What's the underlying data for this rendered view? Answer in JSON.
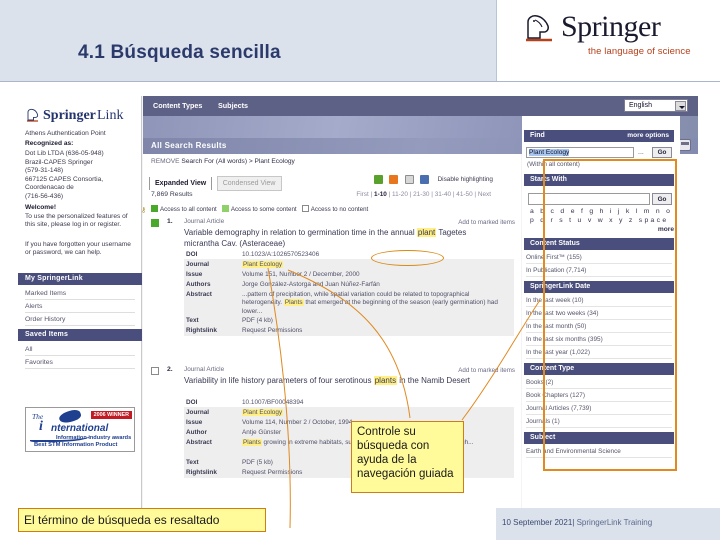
{
  "slide": {
    "title": "4.1 Búsqueda sencilla",
    "brand": {
      "word_bold": "Springer",
      "word_light": "",
      "tagline": "the language of science"
    },
    "footer": {
      "date": "10 September 2021",
      "separator": "|",
      "label": "SpringerLink Training"
    }
  },
  "annotations": {
    "bottom_callout": "El término de búsqueda es resaltado",
    "guided_callout": "Controle su búsqueda con ayuda de la navegación guiada"
  },
  "left_sidebar": {
    "logo": {
      "bold": "Springer",
      "light": "Link"
    },
    "auth_point": "Athens Authentication Point",
    "recognized_label": "Recognized as:",
    "institutions": [
      "Dot Lib LTDA (636-05-948)",
      "Brazil-CAPES Springer",
      "(579-31-148)",
      "667125 CAPES Consortia,",
      "Coordenacao de",
      "(716-56-436)"
    ],
    "welcome_label": "Welcome!",
    "welcome_text": "To use the personalized features of this site, please log in or register.",
    "help_text": "If you have forgotten your username or password, we can help.",
    "sections": [
      {
        "title": "My SpringerLink",
        "items": [
          "Marked Items",
          "Alerts",
          "Order History"
        ]
      },
      {
        "title": "Saved Items",
        "items": [
          "All",
          "Favorites"
        ]
      }
    ],
    "award": {
      "the": "The",
      "name": "nternational",
      "winner": "2006 WINNER",
      "line1": "Information industry awards",
      "line2": "Best STM Information Product"
    }
  },
  "topbar": {
    "menu": [
      "Content Types",
      "Subjects"
    ],
    "language": "English"
  },
  "results_header": {
    "title": "All Search Results",
    "refine_remove": "REMOVE",
    "refine_text": "Search For (All words) > Plant Ecology",
    "tab_expanded": "Expanded View",
    "tab_condensed": "Condensed View",
    "result_count": "7,869 Results",
    "disable_highlighting": "Disable highlighting",
    "pager": [
      "First",
      "1-10",
      "11-20",
      "21-30",
      "31-40",
      "41-50",
      "Next"
    ],
    "legend": [
      "Access to all content",
      "Access to some content",
      "Access to no content"
    ]
  },
  "results": [
    {
      "num": "1.",
      "type": "Journal Article",
      "title_pre": "Variable demography in relation to germination time in the annual ",
      "title_hl": "plant",
      "title_post": " Tagetes micrantha Cav. (Asteraceae)",
      "mark": "Add to marked items",
      "rows": [
        {
          "label": "DOI",
          "value": "10.1023/A:1026570523406"
        },
        {
          "label": "Journal",
          "value": "Plant  Ecology",
          "highlight": true
        },
        {
          "label": "Issue",
          "value": "Volume 151, Number 2 / December, 2000"
        },
        {
          "label": "Authors",
          "value": "Jorge González-Astorga and Juan Núñez-Farfán"
        },
        {
          "label": "Abstract",
          "value_pre": "...pattern of precipitation, while spatial variation could be related to topographical heterogeneity. ",
          "value_hl": "Plants",
          "value_post": " that emerged at the beginning of the season (early germination) had lower..."
        },
        {
          "label": "Text",
          "value": "PDF (4 kb)"
        },
        {
          "label": "Rightslink",
          "value": "Request Permissions"
        }
      ]
    },
    {
      "num": "2.",
      "type": "Journal Article",
      "title_pre": "Variability in life history parameters of four serotinous ",
      "title_hl": "plants",
      "title_post": " in the Namib Desert",
      "mark": "Add to marked items",
      "rows": [
        {
          "label": "DOI",
          "value": "10.1007/BF00048394"
        },
        {
          "label": "Journal",
          "value": "Plant  Ecology",
          "highlight": true
        },
        {
          "label": "Issue",
          "value": "Volume 114, Number 2 / October, 1994"
        },
        {
          "label": "Author",
          "value": "Antje Günster"
        },
        {
          "label": "Abstract",
          "value_pre": "",
          "value_hl": "Plants",
          "value_post": " growing in extreme habitats, such as deserts, are expected to show high..."
        },
        {
          "label": "Text",
          "value": "PDF (5 kb)"
        },
        {
          "label": "Rightslink",
          "value": "Request Permissions"
        }
      ]
    }
  ],
  "right_sidebar": {
    "find": {
      "title": "Find",
      "more_options": "more options",
      "query": "Plant Ecology",
      "dots": "...",
      "go": "Go",
      "within": "(Within all content)"
    },
    "starts_with": {
      "title": "Starts With",
      "go": "Go",
      "alpha_row1": "a b c d e f g h i j k l m n o",
      "alpha_row2": "p q r s t u v w x y z space",
      "more": "more"
    },
    "content_status": {
      "title": "Content Status",
      "items": [
        "Online First™ (155)",
        "In Publication (7,714)"
      ]
    },
    "springerlink_date": {
      "title": "SpringerLink Date",
      "items": [
        "In the last week (10)",
        "In the last two weeks (34)",
        "In the last month (50)",
        "In the last six months (395)",
        "In the last year (1,022)"
      ]
    },
    "content_type": {
      "title": "Content Type",
      "items": [
        "Books (2)",
        "Book Chapters (127)",
        "Journal Articles (7,739)",
        "Journals (1)"
      ]
    },
    "subject": {
      "title": "Subject",
      "items": [
        "Earth and Environmental Science"
      ]
    }
  },
  "colors": {
    "slide_bg": "#dbe2ec",
    "title_blue": "#2b3a6b",
    "panel_header": "#4a4e7c",
    "annotation_yellow": "#fffa9a",
    "annotation_border": "#cf7f12",
    "highlight_yellow": "#ffef84",
    "springer_orange": "#b6401a"
  }
}
